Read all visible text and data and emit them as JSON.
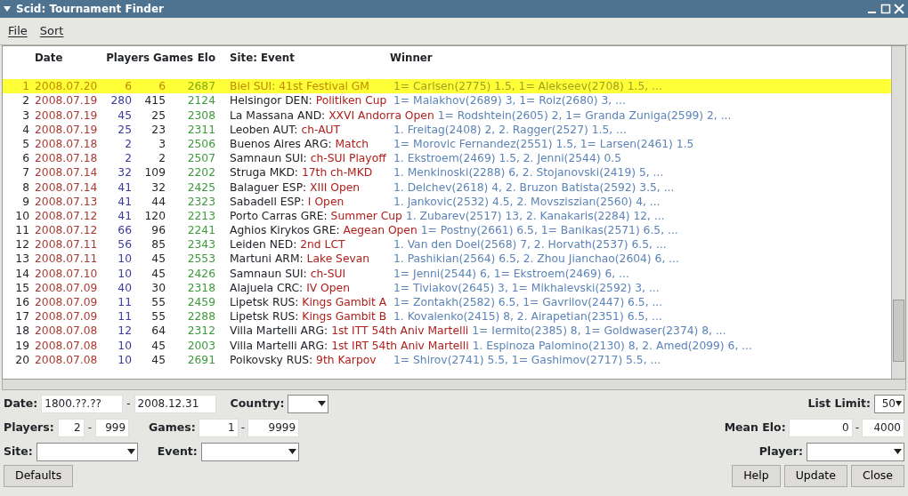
{
  "window": {
    "title": "Scid: Tournament Finder"
  },
  "menu": [
    "File",
    "Sort"
  ],
  "table": {
    "columns": [
      "Date",
      "Players",
      "Games",
      "Elo",
      "Site: Event",
      "Winner"
    ],
    "rows": [
      {
        "num": "1",
        "date": "2008.07.20",
        "players": "6",
        "games": "6",
        "elo": "2687",
        "site": "Biel SUI:",
        "event": "41st Festival GM",
        "winner": "1= Carlsen(2775) 1.5, 1= Alekseev(2708) 1.5, ...",
        "selected": true
      },
      {
        "num": "2",
        "date": "2008.07.19",
        "players": "280",
        "games": "415",
        "elo": "2124",
        "site": "Helsingor DEN:",
        "event": "Politiken Cup",
        "winner": "1= Malakhov(2689) 3, 1= Roiz(2680) 3, ...",
        "selected": false
      },
      {
        "num": "3",
        "date": "2008.07.19",
        "players": "45",
        "games": "25",
        "elo": "2308",
        "site": "La Massana AND:",
        "event": "XXVI Andorra Open",
        "winner": "1= Rodshtein(2605) 2, 1= Granda Zuniga(2599) 2, ...",
        "selected": false
      },
      {
        "num": "4",
        "date": "2008.07.19",
        "players": "25",
        "games": "23",
        "elo": "2311",
        "site": "Leoben AUT:",
        "event": "ch-AUT",
        "winner": "1. Freitag(2408) 2, 2. Ragger(2527) 1.5, ...",
        "selected": false
      },
      {
        "num": "5",
        "date": "2008.07.18",
        "players": "2",
        "games": "3",
        "elo": "2506",
        "site": "Buenos Aires ARG:",
        "event": "Match",
        "winner": "1= Morovic Fernandez(2551) 1.5, 1= Larsen(2461) 1.5",
        "selected": false
      },
      {
        "num": "6",
        "date": "2008.07.18",
        "players": "2",
        "games": "2",
        "elo": "2507",
        "site": "Samnaun SUI:",
        "event": "ch-SUI Playoff",
        "winner": "1. Ekstroem(2469) 1.5, 2. Jenni(2544) 0.5",
        "selected": false
      },
      {
        "num": "7",
        "date": "2008.07.14",
        "players": "32",
        "games": "109",
        "elo": "2202",
        "site": "Struga MKD:",
        "event": "17th ch-MKD",
        "winner": "1. Menkinoski(2288) 6, 2. Stojanovski(2419) 5, ...",
        "selected": false
      },
      {
        "num": "8",
        "date": "2008.07.14",
        "players": "41",
        "games": "32",
        "elo": "2425",
        "site": "Balaguer ESP:",
        "event": "XIII Open",
        "winner": "1. Delchev(2618) 4, 2. Bruzon Batista(2592) 3.5, ...",
        "selected": false
      },
      {
        "num": "9",
        "date": "2008.07.13",
        "players": "41",
        "games": "44",
        "elo": "2323",
        "site": "Sabadell ESP:",
        "event": "I Open",
        "winner": "1. Jankovic(2532) 4.5, 2. Movsziszian(2560) 4, ...",
        "selected": false
      },
      {
        "num": "10",
        "date": "2008.07.12",
        "players": "41",
        "games": "120",
        "elo": "2213",
        "site": "Porto Carras GRE:",
        "event": "Summer Cup",
        "winner": "1. Zubarev(2517) 13, 2. Kanakaris(2284) 12, ...",
        "selected": false
      },
      {
        "num": "11",
        "date": "2008.07.12",
        "players": "66",
        "games": "96",
        "elo": "2241",
        "site": "Aghios Kirykos GRE:",
        "event": "Aegean Open",
        "winner": "1= Postny(2661) 6.5, 1= Banikas(2571) 6.5, ...",
        "selected": false
      },
      {
        "num": "12",
        "date": "2008.07.11",
        "players": "56",
        "games": "85",
        "elo": "2343",
        "site": "Leiden NED:",
        "event": "2nd LCT",
        "winner": "1. Van den Doel(2568) 7, 2. Horvath(2537) 6.5, ...",
        "selected": false
      },
      {
        "num": "13",
        "date": "2008.07.11",
        "players": "10",
        "games": "45",
        "elo": "2553",
        "site": "Martuni ARM:",
        "event": "Lake Sevan",
        "winner": "1. Pashikian(2564) 6.5, 2. Zhou Jianchao(2604) 6, ...",
        "selected": false
      },
      {
        "num": "14",
        "date": "2008.07.10",
        "players": "10",
        "games": "45",
        "elo": "2426",
        "site": "Samnaun SUI:",
        "event": "ch-SUI",
        "winner": "1= Jenni(2544) 6, 1= Ekstroem(2469) 6, ...",
        "selected": false
      },
      {
        "num": "15",
        "date": "2008.07.09",
        "players": "40",
        "games": "30",
        "elo": "2318",
        "site": "Alajuela CRC:",
        "event": "IV Open",
        "winner": "1= Tiviakov(2645) 3, 1= Mikhalevski(2592) 3, ...",
        "selected": false
      },
      {
        "num": "16",
        "date": "2008.07.09",
        "players": "11",
        "games": "55",
        "elo": "2459",
        "site": "Lipetsk RUS:",
        "event": "Kings Gambit A",
        "winner": "1= Zontakh(2582) 6.5, 1= Gavrilov(2447) 6.5, ...",
        "selected": false
      },
      {
        "num": "17",
        "date": "2008.07.09",
        "players": "11",
        "games": "55",
        "elo": "2288",
        "site": "Lipetsk RUS:",
        "event": "Kings Gambit B",
        "winner": "1. Kovalenko(2415) 8, 2. Airapetian(2351) 6.5, ...",
        "selected": false
      },
      {
        "num": "18",
        "date": "2008.07.08",
        "players": "12",
        "games": "64",
        "elo": "2312",
        "site": "Villa Martelli ARG:",
        "event": "1st ITT 54th Aniv Martelli",
        "winner": "1= Iermito(2385) 8, 1= Goldwaser(2374) 8, ...",
        "selected": false
      },
      {
        "num": "19",
        "date": "2008.07.08",
        "players": "10",
        "games": "45",
        "elo": "2003",
        "site": "Villa Martelli ARG:",
        "event": "1st IRT 54th Aniv Martelli",
        "winner": "1. Espinoza Palomino(2130) 8, 2. Amed(2099) 6, ...",
        "selected": false
      },
      {
        "num": "20",
        "date": "2008.07.08",
        "players": "10",
        "games": "45",
        "elo": "2691",
        "site": "Poikovsky RUS:",
        "event": "9th Karpov",
        "winner": "1= Shirov(2741) 5.5, 1= Gashimov(2717) 5.5, ...",
        "selected": false
      }
    ]
  },
  "filters": {
    "date": {
      "label": "Date:",
      "from": "1800.??.??",
      "sep": "-",
      "to": "2008.12.31"
    },
    "country": {
      "label": "Country:"
    },
    "list_limit": {
      "label": "List Limit:",
      "value": "50"
    },
    "players": {
      "label": "Players:",
      "from": "2",
      "sep": "-",
      "to": "999"
    },
    "games": {
      "label": "Games:",
      "from": "1",
      "sep": "-",
      "to": "9999"
    },
    "mean_elo": {
      "label": "Mean Elo:",
      "from": "0",
      "sep": "-",
      "to": "4000"
    },
    "site": {
      "label": "Site:"
    },
    "event": {
      "label": "Event:"
    },
    "player": {
      "label": "Player:"
    }
  },
  "buttons": [
    "Defaults",
    "Help",
    "Update",
    "Close"
  ]
}
